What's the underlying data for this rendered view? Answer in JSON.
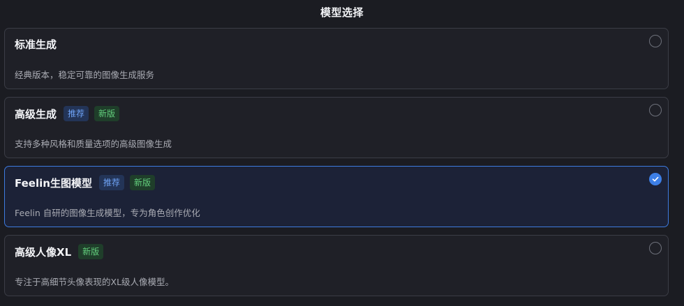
{
  "header": {
    "title": "模型选择"
  },
  "models": [
    {
      "name": "标准生成",
      "description": "经典版本，稳定可靠的图像生成服务",
      "selected": false
    },
    {
      "name": "高级生成",
      "badges": [
        "推荐",
        "新版"
      ],
      "description": "支持多种风格和质量选项的高级图像生成",
      "selected": false
    },
    {
      "name": "Feelin生图模型",
      "badges": [
        "推荐",
        "新版"
      ],
      "description": "Feelin 自研的图像生成模型，专为角色创作优化",
      "selected": true
    },
    {
      "name": "高级人像XL",
      "badges": [
        "新版"
      ],
      "description": "专注于高细节头像表现的XL级人像模型。",
      "selected": false
    }
  ],
  "colors": {
    "accent": "#3d7fe6",
    "recommend_badge": "#6ea2f5",
    "new_badge": "#63cf7d",
    "background": "#1b1c22"
  },
  "icons": {
    "selected_indicator": "checkmark-icon",
    "unselected_indicator": "radio-empty-icon"
  }
}
